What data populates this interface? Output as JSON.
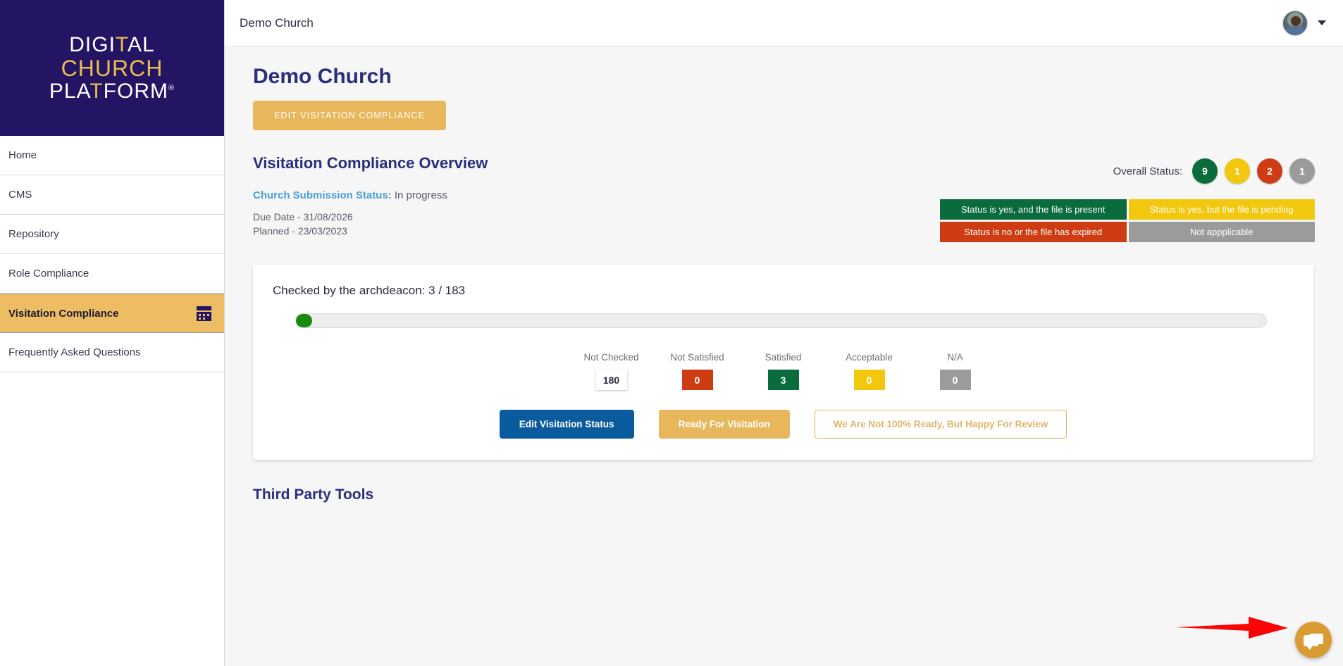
{
  "brand": {
    "line1": "DIGI",
    "line1_cross": "T",
    "line1_end": "AL",
    "line2": "CHURCH",
    "line3a": "PLA",
    "line3_cross": "T",
    "line3b": "FORM",
    "registered": "®"
  },
  "sidebar": {
    "items": [
      {
        "label": "Home",
        "icon": "",
        "active": false
      },
      {
        "label": "CMS",
        "icon": "",
        "active": false
      },
      {
        "label": "Repository",
        "icon": "",
        "active": false
      },
      {
        "label": "Role Compliance",
        "icon": "",
        "active": false
      },
      {
        "label": "Visitation Compliance",
        "icon": "calendar-icon",
        "active": true
      },
      {
        "label": "Frequently Asked Questions",
        "icon": "",
        "active": false
      }
    ]
  },
  "topbar": {
    "title": "Demo Church",
    "avatar_icon": "user-avatar",
    "chevron_icon": "chevron-down-icon"
  },
  "main": {
    "page_title": "Demo Church",
    "edit_compliance_button": "EDIT VISITATION COMPLIANCE",
    "section_title": "Visitation Compliance Overview",
    "submission_label": "Church Submission Status:",
    "submission_value": "In progress",
    "due_date": "Due Date - 31/08/2026",
    "planned": "Planned - 23/03/2023",
    "third_party_title": "Third Party Tools"
  },
  "overall_status": {
    "label": "Overall Status:",
    "badges": [
      {
        "value": "9",
        "color": "#0a6b3c"
      },
      {
        "value": "1",
        "color": "#f2c80f"
      },
      {
        "value": "2",
        "color": "#cd3c13"
      },
      {
        "value": "1",
        "color": "#9b9b9b"
      }
    ]
  },
  "legend": [
    {
      "text": "Status is yes, and the file is present",
      "color": "#0a6b3c"
    },
    {
      "text": "Status is yes, but the file is pending",
      "color": "#f2c80f"
    },
    {
      "text": "Status is no or the file has expired",
      "color": "#cd3c13"
    },
    {
      "text": "Not appplicable",
      "color": "#9b9b9b"
    }
  ],
  "progress_card": {
    "heading": "Checked by the archdeacon: 3 / 183",
    "checked": 3,
    "total": 183,
    "percent": 1.64,
    "fill_color": "#188a0c",
    "counters": [
      {
        "label": "Not Checked",
        "value": "180",
        "color": "#ffffff",
        "white": true
      },
      {
        "label": "Not Satisfied",
        "value": "0",
        "color": "#cd3c13",
        "white": false
      },
      {
        "label": "Satisfied",
        "value": "3",
        "color": "#0a6b3c",
        "white": false
      },
      {
        "label": "Acceptable",
        "value": "0",
        "color": "#f2c80f",
        "white": false
      },
      {
        "label": "N/A",
        "value": "0",
        "color": "#9b9b9b",
        "white": false
      }
    ],
    "buttons": {
      "edit_status": "Edit Visitation Status",
      "ready": "Ready For Visitation",
      "not_ready": "We Are Not 100% Ready, But Happy For Review"
    }
  },
  "chat": {
    "icon": "chat-bubbles-icon",
    "color": "#d99b34"
  },
  "annotation": {
    "icon": "red-arrow-pointer",
    "color": "#f90505"
  }
}
